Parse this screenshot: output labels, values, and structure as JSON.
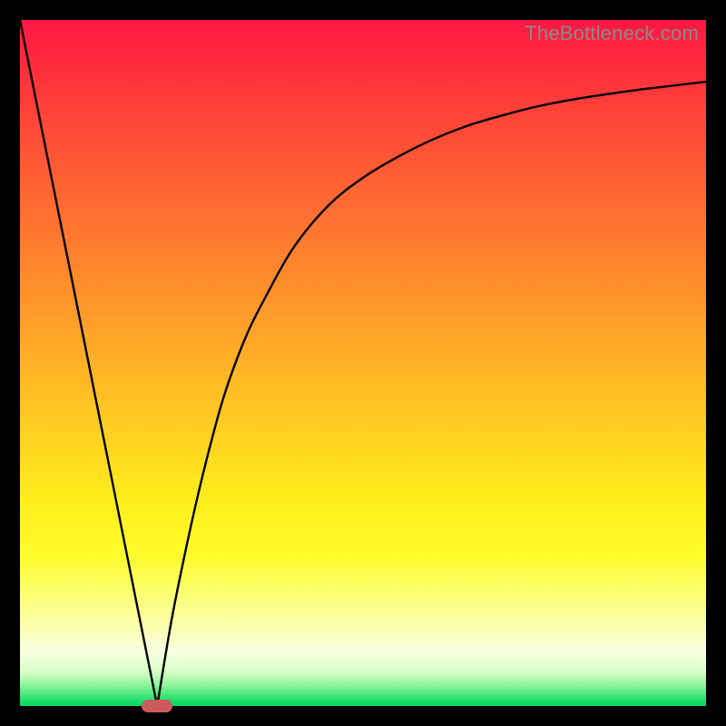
{
  "watermark": "TheBottleneck.com",
  "colors": {
    "frame": "#000000",
    "curve": "#000000",
    "marker": "#cc5c5c",
    "gradient_top": "#ff1744",
    "gradient_bottom": "#00d85e"
  },
  "chart_data": {
    "type": "line",
    "title": "",
    "xlabel": "",
    "ylabel": "",
    "xlim": [
      0,
      100
    ],
    "ylim": [
      0,
      100
    ],
    "annotations": [
      {
        "name": "optimal-marker",
        "x": 20,
        "y": 0
      }
    ],
    "series": [
      {
        "name": "left-branch",
        "x": [
          0,
          2,
          4,
          6,
          8,
          10,
          12,
          14,
          16,
          18,
          19,
          20
        ],
        "values": [
          100,
          90,
          80,
          70,
          60,
          50,
          40,
          30,
          20,
          10,
          5,
          0
        ]
      },
      {
        "name": "right-branch",
        "x": [
          20,
          22,
          24,
          26,
          28,
          30,
          33,
          36,
          40,
          45,
          50,
          55,
          60,
          65,
          70,
          75,
          80,
          85,
          90,
          95,
          100
        ],
        "values": [
          0,
          12,
          22,
          31,
          39,
          46,
          54,
          60,
          67,
          73,
          77,
          80,
          82.5,
          84.5,
          86,
          87.3,
          88.3,
          89.1,
          89.8,
          90.4,
          91
        ]
      }
    ]
  }
}
